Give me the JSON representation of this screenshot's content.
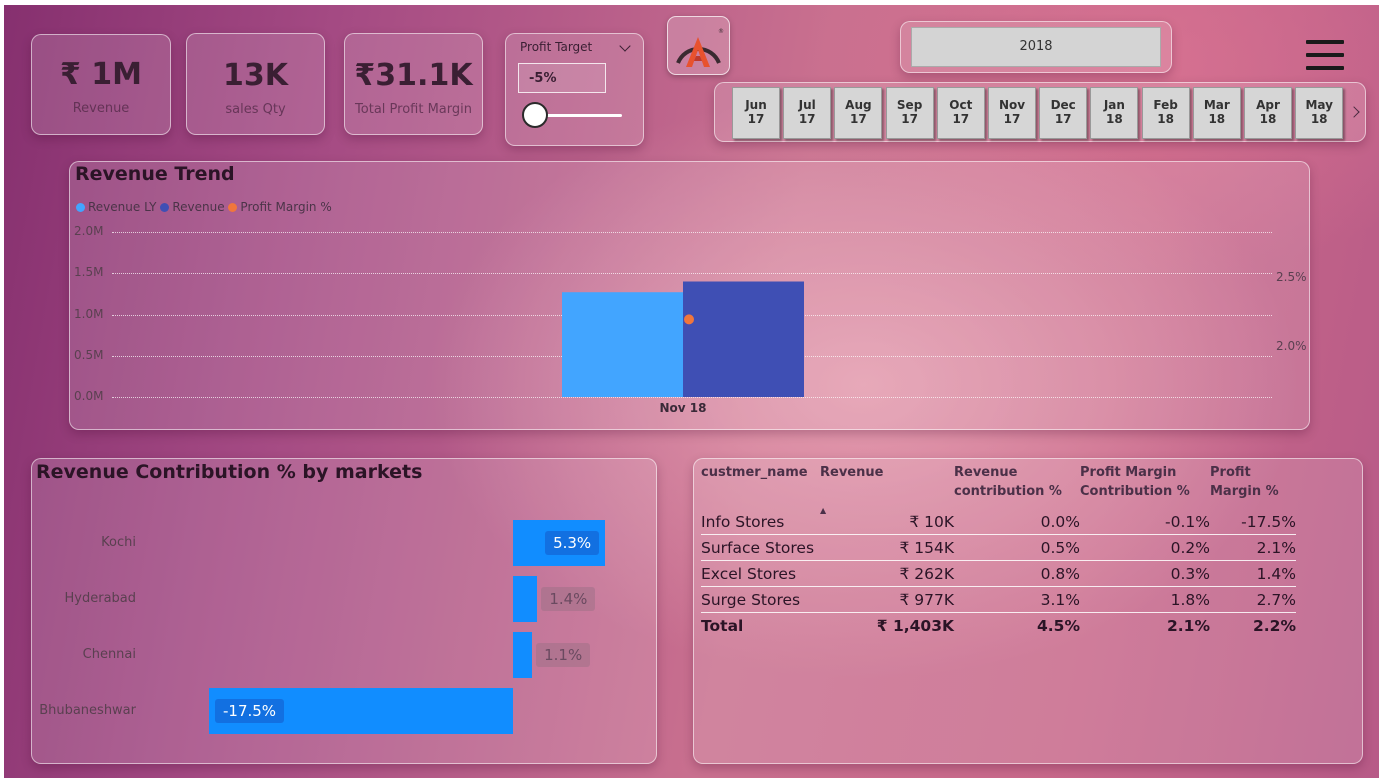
{
  "kpis": [
    {
      "value": "₹ 1M",
      "label": "Revenue"
    },
    {
      "value": "13K",
      "label": "sales Qty"
    },
    {
      "value": "₹31.1K",
      "label": "Total Profit Margin"
    }
  ],
  "profit_target": {
    "title": "Profit Target",
    "value": "-5%",
    "slider_fraction": 0.0
  },
  "year_slicer": {
    "selected": "2018"
  },
  "months": [
    {
      "m": "Jun",
      "y": "17"
    },
    {
      "m": "Jul",
      "y": "17"
    },
    {
      "m": "Aug",
      "y": "17"
    },
    {
      "m": "Sep",
      "y": "17"
    },
    {
      "m": "Oct",
      "y": "17"
    },
    {
      "m": "Nov",
      "y": "17"
    },
    {
      "m": "Dec",
      "y": "17"
    },
    {
      "m": "Jan",
      "y": "18"
    },
    {
      "m": "Feb",
      "y": "18"
    },
    {
      "m": "Mar",
      "y": "18"
    },
    {
      "m": "Apr",
      "y": "18"
    },
    {
      "m": "May",
      "y": "18"
    }
  ],
  "revenue_trend": {
    "title": "Revenue Trend",
    "legend": [
      "Revenue LY",
      "Revenue",
      "Profit Margin %"
    ],
    "colors": {
      "revenue_ly": "#42a5ff",
      "revenue": "#3f4fb4",
      "profit_margin": "#f0763c"
    },
    "y_ticks": [
      "2.0M",
      "1.5M",
      "1.0M",
      "0.5M",
      "0.0M"
    ],
    "y2_ticks": [
      "2.5%",
      "2.0%"
    ]
  },
  "markets": {
    "title": "Revenue Contribution % by markets",
    "bar_color": "#118dff"
  },
  "table": {
    "headers": [
      "custmer_name",
      "Revenue",
      "Revenue contribution %",
      "Profit Margin Contribution %",
      "Profit Margin %"
    ],
    "rows": [
      [
        "Info Stores",
        "₹ 10K",
        "0.0%",
        "-0.1%",
        "-17.5%"
      ],
      [
        "Surface Stores",
        "₹ 154K",
        "0.5%",
        "0.2%",
        "2.1%"
      ],
      [
        "Excel Stores",
        "₹ 262K",
        "0.8%",
        "0.3%",
        "1.4%"
      ],
      [
        "Surge Stores",
        "₹ 977K",
        "3.1%",
        "1.8%",
        "2.7%"
      ]
    ],
    "total": [
      "Total",
      "₹ 1,403K",
      "4.5%",
      "2.1%",
      "2.2%"
    ]
  },
  "chart_data": [
    {
      "type": "bar",
      "title": "Revenue Trend",
      "categories": [
        "Nov 18"
      ],
      "series": [
        {
          "name": "Revenue LY",
          "values": [
            1.27
          ]
        },
        {
          "name": "Revenue",
          "values": [
            1.4
          ]
        },
        {
          "name": "Profit Margin %",
          "values": [
            2.2
          ]
        }
      ],
      "ylim": [
        0,
        2.0
      ],
      "y2lim": [
        1.6,
        2.7
      ],
      "grid": true,
      "legend": "top-left"
    },
    {
      "type": "bar",
      "title": "Revenue Contribution % by markets",
      "categories": [
        "Kochi",
        "Hyderabad",
        "Chennai",
        "Bhubaneshwar"
      ],
      "values": [
        5.3,
        1.4,
        1.1,
        -17.5
      ],
      "labels": [
        "5.3%",
        "1.4%",
        "1.1%",
        "-17.5%"
      ]
    }
  ]
}
